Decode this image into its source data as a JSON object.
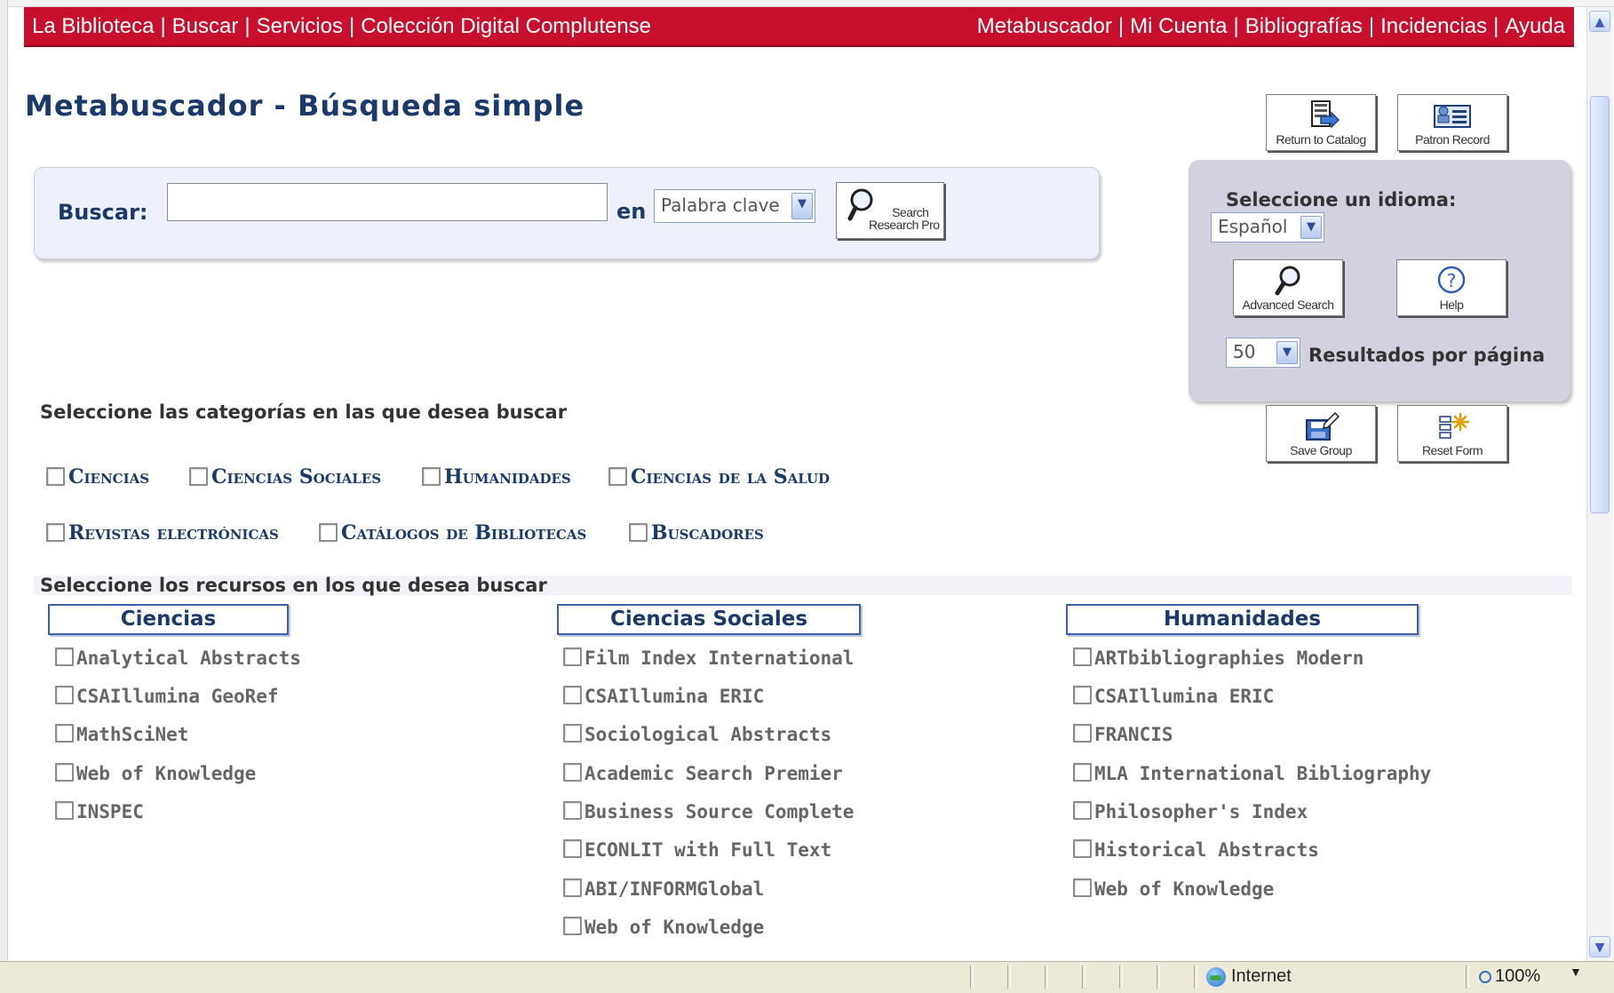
{
  "topnav": {
    "left": [
      "La Biblioteca",
      "Buscar",
      "Servicios",
      "Colección Digital Complutense"
    ],
    "right": [
      "Metabuscador",
      "Mi Cuenta",
      "Bibliografías",
      "Incidencias",
      "Ayuda"
    ],
    "separator": "|"
  },
  "page_title": "Metabuscador - Búsqueda simple",
  "search": {
    "label": "Buscar:",
    "value": "",
    "in_label": "en",
    "field_select": "Palabra clave",
    "search_button": [
      "Search",
      "Research Pro"
    ]
  },
  "toolbar": {
    "return_catalog": "Return to Catalog",
    "patron_record": "Patron Record",
    "advanced_search": "Advanced Search",
    "help": "Help",
    "save_group": "Save Group",
    "reset_form": "Reset Form"
  },
  "language": {
    "label": "Seleccione un idioma:",
    "value": "Español"
  },
  "results_per_page": {
    "value": "50",
    "label": "Resultados por página"
  },
  "categories": {
    "title": "Seleccione las categorías en las que desea buscar",
    "items": [
      "Ciencias",
      "Ciencias Sociales",
      "Humanidades",
      "Ciencias de la Salud",
      "Revistas electrónicas",
      "Catálogos de Bibliotecas",
      "Buscadores"
    ]
  },
  "resources": {
    "title": "Seleccione los recursos en los que desea buscar",
    "columns": [
      {
        "header": "Ciencias",
        "items": [
          "Analytical Abstracts",
          "CSAIllumina GeoRef",
          "MathSciNet",
          "Web of Knowledge",
          "INSPEC"
        ]
      },
      {
        "header": "Ciencias Sociales",
        "items": [
          "Film Index International",
          "CSAIllumina ERIC",
          "Sociological Abstracts",
          "Academic Search Premier",
          "Business Source Complete",
          "ECONLIT with Full Text",
          "ABI/INFORMGlobal",
          "Web of Knowledge"
        ]
      },
      {
        "header": "Humanidades",
        "items": [
          "ARTbibliographies Modern",
          "CSAIllumina ERIC",
          "FRANCIS",
          "MLA International Bibliography",
          "Philosopher's Index",
          "Historical Abstracts",
          "Web of Knowledge"
        ]
      }
    ]
  },
  "statusbar": {
    "zone": "Internet",
    "zoom": "100%"
  },
  "colors": {
    "nav_red": "#c8102e",
    "title_blue": "#1b3a6b",
    "panel_lavender": "#d3d1df"
  }
}
